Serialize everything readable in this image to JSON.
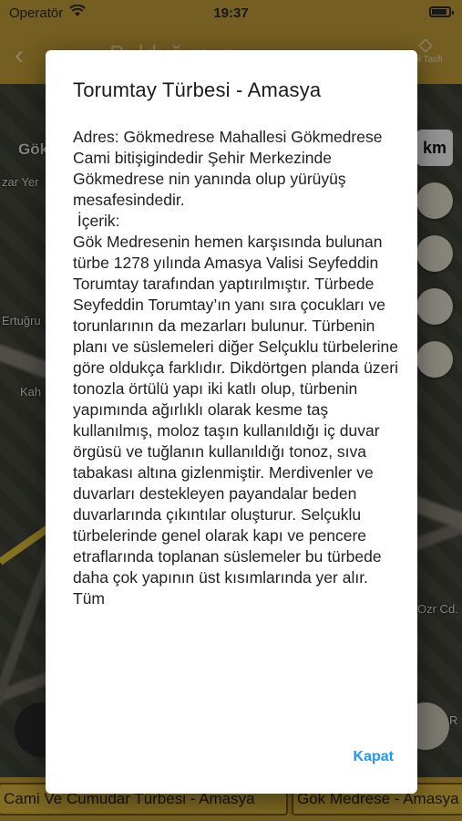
{
  "status_bar": {
    "carrier": "Operatör",
    "time": "19:37"
  },
  "app_bar": {
    "back_icon": "chevron-left-icon",
    "title": "Bulduğunuz",
    "route_label": "Yol Tarifi",
    "route_icon": "directions-icon"
  },
  "map": {
    "labels": [
      "Gök",
      "Ertuğru",
      "Kah",
      "zar Yer",
      "Ozr Cd.",
      "SPAR"
    ],
    "scale_label": "km"
  },
  "tabs": [
    {
      "label": "Cami Ve Cumudar Türbesi - Amasya"
    },
    {
      "label": "Gök Medrese - Amasya"
    }
  ],
  "dialog": {
    "title": "Torumtay Türbesi - Amasya",
    "body": "Adres: Gökmedrese Mahallesi Gökmedrese Cami bitişigindedir Şehir Merkezinde Gökmedrese nin yanında olup yürüyüş mesafesindedir.\n İçerik:\nGök Medresenin hemen karşısında bulunan türbe 1278 yılında Amasya Valisi Seyfeddin Torumtay tarafından yaptırılmıştır. Türbede Seyfeddin Torumtay’ın yanı sıra çocukları ve torunlarının da mezarları bulunur. Türbenin planı ve süslemeleri diğer Selçuklu türbelerine göre oldukça farklıdır. Dikdörtgen planda üzeri tonozla örtülü yapı iki katlı olup, türbenin yapımında ağırlıklı olarak kesme taş kullanılmış, moloz taşın kullanıldığı iç duvar örgüsü ve tuğlanın kullanıldığı tonoz, sıva tabakası altına gizlenmiştir. Merdivenler ve duvarları destekleyen payandalar beden duvarlarında çıkıntılar oluşturur. Selçuklu türbelerinde genel olarak kapı ve pencere etraflarında toplanan süslemeler bu türbede daha çok yapının üst kısımlarında yer alır. Tüm",
    "close_label": "Kapat",
    "accent_color": "#2196f3"
  }
}
